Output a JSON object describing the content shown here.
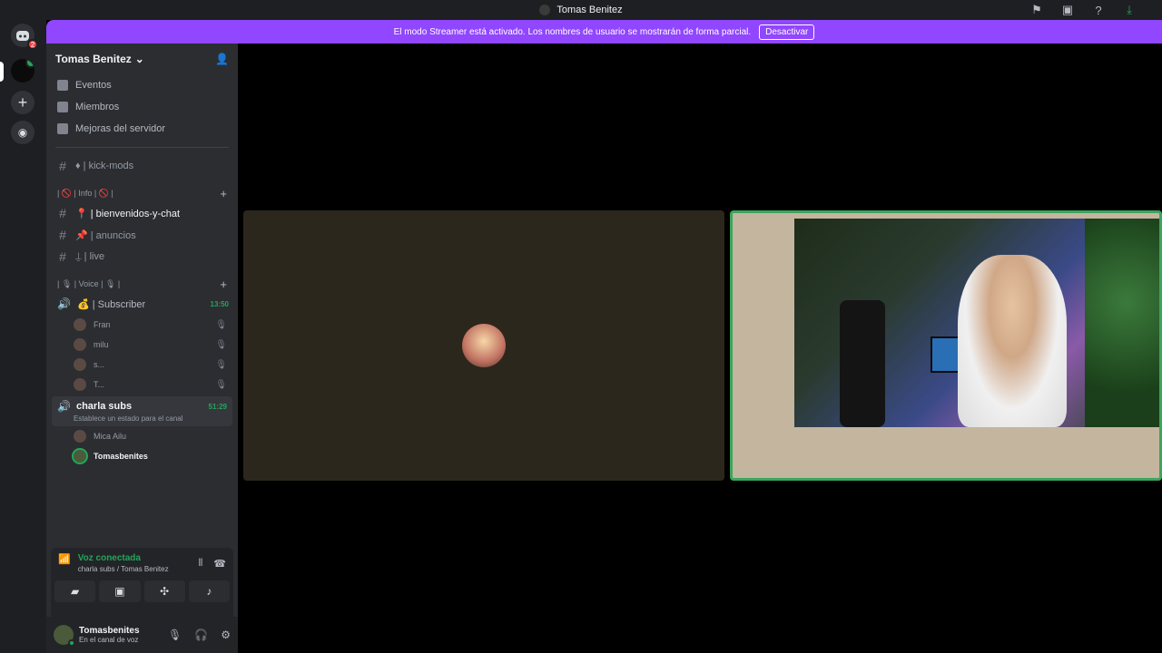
{
  "titlebar": {
    "title": "Tomas Benitez"
  },
  "banner": {
    "message": "El modo Streamer está activado. Los nombres de usuario se mostrarán de forma parcial.",
    "button": "Desactivar"
  },
  "rail": {
    "home_badge": "2"
  },
  "server": {
    "name": "Tomas Benitez",
    "menu": [
      "Eventos",
      "Miembros",
      "Mejoras del servidor"
    ]
  },
  "channels": {
    "kick": "♦ | kick-mods",
    "info_category": "| 🚫 | Info | 🚫 |",
    "text": [
      {
        "name": "📍 | bienvenidos-y-chat",
        "active": true
      },
      {
        "name": "📌 | anuncios",
        "active": false
      },
      {
        "name": "⍊ | live",
        "active": false
      }
    ],
    "voice_category": "| 🎙 | Voice | 🎙 |",
    "subscriber": {
      "name": "💰 | Subscriber",
      "time": "13:50"
    },
    "subscriber_users": [
      "Fran",
      "milu",
      "s...",
      "T..."
    ],
    "charla": {
      "name": "charla subs",
      "time": "51:29",
      "status": "Establece un estado para el canal"
    },
    "charla_users": [
      "Mica Ailu",
      "Tomasbenites"
    ]
  },
  "voice_panel": {
    "title": "Voz conectada",
    "subtitle": "charla subs / Tomas Benitez"
  },
  "userbar": {
    "name": "Tomasbenites",
    "status": "En el canal de voz"
  },
  "colors": {
    "accent": "#9146ff",
    "online": "#23a55a"
  }
}
